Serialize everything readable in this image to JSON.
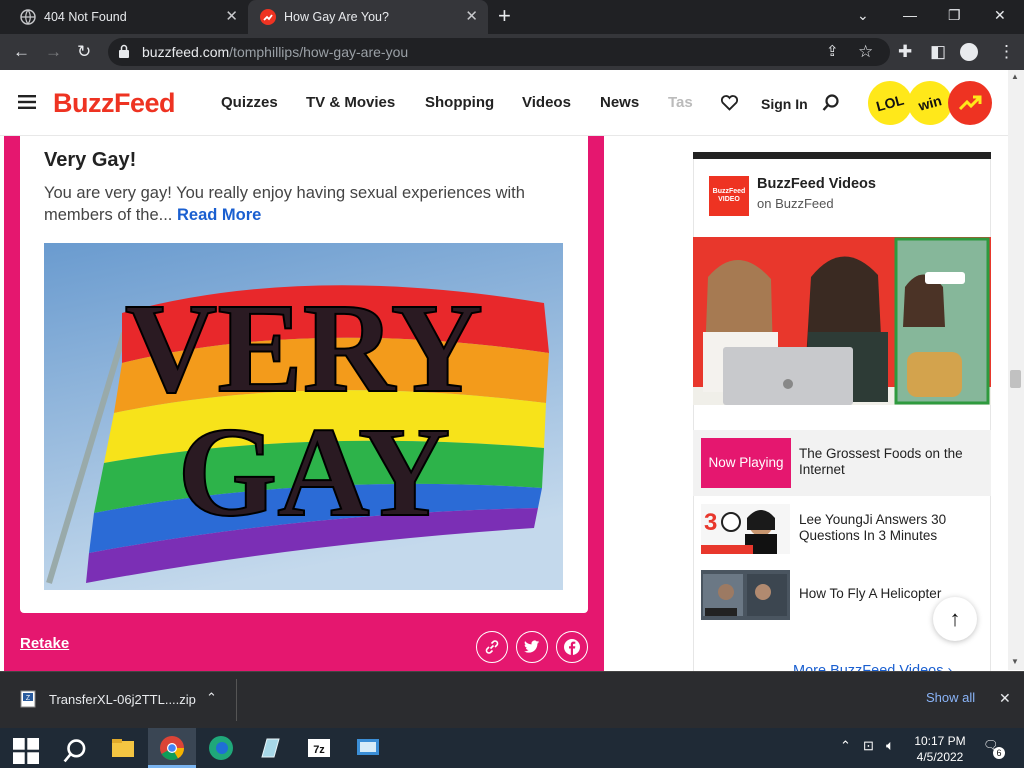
{
  "browser": {
    "tabs": [
      {
        "title": "404 Not Found",
        "active": false
      },
      {
        "title": "How Gay Are You?",
        "active": true
      }
    ],
    "url_domain": "buzzfeed.com",
    "url_path": "/tomphillips/how-gay-are-you"
  },
  "site": {
    "logo": "BuzzFeed",
    "nav": [
      "Quizzes",
      "TV & Movies",
      "Shopping",
      "Videos",
      "News",
      "Tas"
    ],
    "sign_in": "Sign In",
    "badges": [
      "LOL",
      "win"
    ],
    "brand_color": "#ee3322"
  },
  "result": {
    "title": "Very Gay!",
    "description": "You are very gay! You really enjoy having sexual experiences with members of the...",
    "read_more": "Read More",
    "image_text_line1": "VERY",
    "image_text_line2": "GAY",
    "retake": "Retake",
    "accent_color": "#e5176f"
  },
  "sidebar": {
    "channel_name": "BuzzFeed Videos",
    "channel_sub": "on BuzzFeed",
    "channel_logo_text": "BuzzFeed VIDEO",
    "now_playing": "Now Playing",
    "videos": [
      {
        "title": "The Grossest Foods on the Internet"
      },
      {
        "title": "Lee YoungJi Answers 30 Questions In 3 Minutes"
      },
      {
        "title": "How To Fly A Helicopter"
      }
    ],
    "more": "More BuzzFeed Videos ›"
  },
  "downloads": {
    "file_name": "TransferXL-06j2TTL....zip",
    "show_all": "Show all"
  },
  "taskbar": {
    "time": "10:17 PM",
    "date": "4/5/2022",
    "notifications": "6"
  }
}
